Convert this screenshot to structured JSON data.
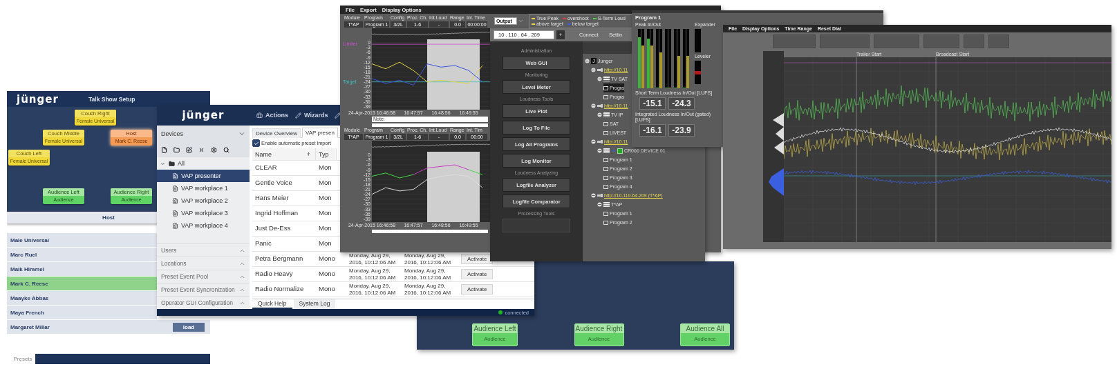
{
  "talk_show": {
    "logo": "jünger",
    "title": "Talk Show Setup",
    "seats": [
      {
        "name": "Couch Right",
        "preset": "Female Universal",
        "kind": "couch"
      },
      {
        "name": "Couch Middle",
        "preset": "Female Universal",
        "kind": "couch"
      },
      {
        "name": "Couch Left",
        "preset": "Female Universal",
        "kind": "couch"
      },
      {
        "name": "Host",
        "preset": "Mark C. Reese",
        "kind": "host"
      },
      {
        "name": "Audience Left",
        "preset": "Audience",
        "kind": "audience"
      },
      {
        "name": "Audience Right",
        "preset": "Audience",
        "kind": "audience"
      }
    ],
    "stage_caption": "Host",
    "presets": [
      {
        "name": "Male Universal",
        "selected": false
      },
      {
        "name": "Marc Ruel",
        "selected": false
      },
      {
        "name": "Maik Himmel",
        "selected": false
      },
      {
        "name": "Mark C. Reese",
        "selected": true
      },
      {
        "name": "Maayke Abbas",
        "selected": false
      },
      {
        "name": "Maya French",
        "selected": false
      },
      {
        "name": "Margaret Millar",
        "selected": false
      }
    ],
    "load_button": "load",
    "tab": "Presets"
  },
  "audience_panel": {
    "buttons": [
      {
        "name": "Audience Left",
        "preset": "Audience"
      },
      {
        "name": "Audience Right",
        "preset": "Audience"
      },
      {
        "name": "Audience All",
        "preset": "Audience"
      }
    ]
  },
  "device_manager": {
    "logo": "jünger",
    "nav": [
      "Actions",
      "Wizards"
    ],
    "sidebar": {
      "title": "Devices",
      "tree": {
        "label": "All",
        "expanded": true,
        "children": [
          {
            "label": "VAP presenter",
            "selected": true
          },
          {
            "label": "VAP workplace 1",
            "selected": false
          },
          {
            "label": "VAP workplace 2",
            "selected": false
          },
          {
            "label": "VAP workplace 3",
            "selected": false
          },
          {
            "label": "VAP workplace 4",
            "selected": false
          }
        ]
      },
      "sections": [
        "Users",
        "Locations",
        "Preset Event Pool",
        "Preset Event Syncronization",
        "Operator GUI Configuration"
      ]
    },
    "tabs": [
      {
        "label": "Device Overview",
        "selected": false
      },
      {
        "label": "VAP presen",
        "selected": true
      }
    ],
    "auto_import": {
      "label": "Enable automatic preset import",
      "checked": true
    },
    "table": {
      "columns": [
        "Name",
        "Typ"
      ],
      "rows": [
        {
          "cells": [
            "CLEAR",
            "Mon"
          ]
        },
        {
          "cells": [
            "Gentle Voice",
            "Mon"
          ]
        },
        {
          "cells": [
            "Hans Meier",
            "Mon"
          ]
        },
        {
          "cells": [
            "Ingrid Hoffman",
            "Mon"
          ]
        },
        {
          "cells": [
            "Just De-Ess",
            "Mon"
          ]
        },
        {
          "cells": [
            "Panic",
            "Mon"
          ]
        },
        {
          "cells": [
            "Petra Bergmann",
            "Mono",
            "Monday, Aug 29, 2016, 10:12:06 AM",
            "Monday, Aug 29, 2016, 10:12:06 AM"
          ],
          "action": "Activate"
        },
        {
          "cells": [
            "Radio Heavy",
            "Mono",
            "Monday, Aug 29, 2016, 10:12:06 AM",
            "Monday, Aug 29, 2016, 10:12:06 AM"
          ],
          "action": "Activate"
        },
        {
          "cells": [
            "Radio Normalize",
            "Mono",
            "Monday, Aug 29, 2016, 10:12:06 AM",
            "Monday, Aug 29, 2016, 10:12:06 AM"
          ],
          "action": "Activate"
        }
      ]
    },
    "bottom_tabs": [
      {
        "label": "Quick Help",
        "selected": true
      },
      {
        "label": "System Log",
        "selected": false
      }
    ],
    "status": "connected"
  },
  "plot_window": {
    "menu": [
      "File",
      "Export",
      "Display Options"
    ],
    "output": "Output",
    "legend": [
      {
        "label": "True Peak",
        "color": "#e8d84a"
      },
      {
        "label": "overshoot",
        "color": "#e04040"
      },
      {
        "label": "S-Term Loud",
        "color": "#4ccf4c"
      },
      {
        "label": "above target",
        "color": "#e8d84a"
      },
      {
        "label": "below target",
        "color": "#3a5fe0"
      }
    ],
    "plots": [
      {
        "fields": [
          {
            "label": "Module",
            "value": "T*AP"
          },
          {
            "label": "Program",
            "value": "Program 1"
          },
          {
            "label": "Config",
            "value": "3/2L"
          },
          {
            "label": "Proc. Ch.",
            "value": "1-6"
          },
          {
            "label": "Int.Loud",
            "value": "-"
          },
          {
            "label": "Range",
            "value": "0.0"
          },
          {
            "label": "Int. Time",
            "value": "00:00:00"
          }
        ],
        "chart_data": {
          "type": "line",
          "categories": [
            "24-Apr-2015 16:46:58",
            null,
            null,
            "16:47:57",
            null,
            "16:48:56",
            null,
            "16:49:55",
            null,
            null,
            null,
            null,
            null,
            null,
            null,
            null,
            null,
            null,
            null,
            null,
            null,
            null,
            null,
            null,
            null
          ],
          "ylim": [
            -41,
            2
          ],
          "yticks": [
            0,
            -3,
            -6,
            -9,
            -12,
            -15,
            -18,
            -21,
            -24,
            -27,
            -30,
            -33,
            -36,
            -39
          ],
          "grid": true,
          "ref_lines": [
            {
              "axis": "y",
              "value": -1,
              "label": "Limiter",
              "color": "#d050d0"
            },
            {
              "axis": "y",
              "value": -24,
              "label": "Target",
              "color": "#40c0c0"
            }
          ],
          "series": [
            {
              "color": "#e2d443",
              "values": [
                -13,
                -16,
                -12,
                -17,
                -24,
                -23,
                -24,
                -25,
                -14,
                null,
                null,
                null,
                null,
                null,
                null,
                null,
                null,
                null,
                null,
                null,
                null,
                null,
                null,
                null,
                null
              ]
            },
            {
              "color": "#3b55e0",
              "values": [
                -22,
                -25,
                -23,
                -26,
                -13,
                -15,
                -14,
                -17,
                -24,
                null,
                null,
                null,
                null,
                null,
                null,
                null,
                null,
                null,
                null,
                null,
                null,
                null,
                null,
                null,
                null
              ]
            }
          ]
        },
        "note": "Note:"
      },
      {
        "fields": [
          {
            "label": "Module",
            "value": "T*AP"
          },
          {
            "label": "Program",
            "value": "Program 1"
          },
          {
            "label": "Config",
            "value": "3/2L"
          },
          {
            "label": "Proc. Ch.",
            "value": "1-6"
          },
          {
            "label": "Int.Loud",
            "value": "-"
          },
          {
            "label": "Range",
            "value": "0.0"
          },
          {
            "label": "Int. Tim",
            "value": "00:00"
          }
        ],
        "chart_data": {
          "type": "line",
          "categories": [
            "24-Apr-2015 16:46:58",
            null,
            null,
            "16:47:57",
            null,
            "16:48:56",
            null,
            "16:49:55",
            null,
            null,
            null,
            null,
            null,
            null,
            null,
            null,
            null,
            null,
            null,
            null,
            null,
            null,
            null,
            null,
            null
          ],
          "ylim": [
            -41,
            2
          ],
          "yticks": [
            0,
            -3,
            -6,
            -9,
            -12,
            -15,
            -18,
            -21,
            -24,
            -27,
            -30,
            -33,
            -36,
            -39
          ],
          "grid": true,
          "series": [
            {
              "color": "#45d845",
              "values": [
                -13,
                -11,
                -14,
                -12,
                null,
                null,
                null,
                -9,
                -12,
                null,
                null,
                null,
                null,
                null,
                null,
                null,
                null,
                null,
                null,
                null,
                null,
                null,
                null,
                null,
                null
              ]
            },
            {
              "color": "#c33ec3",
              "values": [
                null,
                null,
                null,
                -12,
                -8,
                -7,
                -6,
                -9,
                null,
                null,
                null,
                null,
                null,
                null,
                null,
                null,
                null,
                null,
                null,
                null,
                null,
                null,
                null,
                null,
                null
              ]
            },
            {
              "color": "#dddddd",
              "values": [
                -24,
                -20,
                -22,
                -21,
                -15,
                -13,
                -12,
                -13,
                -20,
                null,
                null,
                null,
                null,
                null,
                null,
                null,
                null,
                null,
                null,
                null,
                null,
                null,
                null,
                null,
                null
              ]
            }
          ]
        }
      }
    ]
  },
  "launcher": {
    "ip": "10 . 110 . 64 . 209",
    "add": "+",
    "connect": "Connect",
    "settings": "Settin",
    "groups": [
      {
        "heading": "Administration",
        "buttons": [
          {
            "label": "Web GUI",
            "disabled": false
          }
        ]
      },
      {
        "heading": "Monitoring",
        "buttons": [
          {
            "label": "Level Meter",
            "disabled": false
          }
        ]
      },
      {
        "heading": "Loudness Tools",
        "buttons": [
          {
            "label": "Live Plot",
            "disabled": false
          },
          {
            "label": "Log To File",
            "disabled": false
          },
          {
            "label": "Log All Programs",
            "disabled": false
          },
          {
            "label": "Log Monitor",
            "disabled": false
          }
        ]
      },
      {
        "heading": "Loudness Analyzing",
        "buttons": [
          {
            "label": "Logfile Analyzer",
            "disabled": false
          },
          {
            "label": "Logfile Comparator",
            "disabled": false
          }
        ]
      },
      {
        "heading": "Processing Tools",
        "buttons": [
          {
            "disabled": true
          }
        ]
      }
    ],
    "tree": {
      "label": "Junger",
      "badge": "J",
      "kind": "root",
      "children": [
        {
          "label": "http://10.11",
          "kind": "link",
          "children": [
            {
              "label": "TV SAT",
              "kind": "device",
              "children": [
                {
                  "label": "Progra",
                  "kind": "program",
                  "selected": true
                },
                {
                  "label": "Progra",
                  "kind": "program",
                  "selected": false
                }
              ]
            }
          ]
        },
        {
          "label": "http://10.11",
          "kind": "link",
          "children": [
            {
              "label": "TV IP",
              "kind": "device",
              "children": [
                {
                  "label": "SAT",
                  "kind": "program",
                  "selected": false
                },
                {
                  "label": "LIVEST",
                  "kind": "program",
                  "selected": false
                }
              ]
            }
          ]
        },
        {
          "label": "http://10.11",
          "kind": "link",
          "children": [
            {
              "label": "CR066 DEVICE 01",
              "kind": "device",
              "checked": true,
              "children": [
                {
                  "label": "Program 1",
                  "kind": "program",
                  "selected": false
                },
                {
                  "label": "Program 2",
                  "kind": "program",
                  "selected": false
                },
                {
                  "label": "Program 3",
                  "kind": "program",
                  "selected": false
                },
                {
                  "label": "Program 4",
                  "kind": "program",
                  "selected": false
                }
              ]
            }
          ]
        },
        {
          "label": "http://10.110.64.209 (T*AP)",
          "kind": "link",
          "children": [
            {
              "label": "T*AP",
              "kind": "device",
              "children": [
                {
                  "label": "Program 1",
                  "kind": "program",
                  "selected": false
                },
                {
                  "label": "Program 2",
                  "kind": "program",
                  "selected": false
                }
              ]
            }
          ]
        }
      ]
    }
  },
  "meter_window": {
    "title": "Program 1",
    "peak_label": "Peak In/Out",
    "meters": [
      {
        "input": {
          "level": 0.86
        },
        "output": {
          "level": 0.72
        }
      },
      {
        "input": {
          "level": 0.84
        },
        "output": {
          "level": 0.72
        }
      },
      {
        "input": {
          "level": 0
        },
        "output": {
          "level": 0.6
        }
      },
      {
        "input": {
          "level": 0
        },
        "output": {
          "level": 0
        }
      },
      {
        "input": {
          "level": 0
        },
        "output": {
          "level": 0.55
        }
      },
      {
        "input": {
          "level": 0
        },
        "output": {
          "level": 0.55
        }
      }
    ],
    "expander_label": "Expander",
    "leveler_label": "Leveler",
    "short_term": {
      "label": "Short Term Loudness In/Out [LUFS]",
      "values": [
        "-15.1",
        "-24.3"
      ]
    },
    "integrated": {
      "label": "Integrated Loudness In/Out (gated) [LUFS]",
      "values": [
        "-16.1",
        "-23.9"
      ]
    }
  },
  "trend_window": {
    "menu": [
      "File",
      "Display Options",
      "Time Range",
      "Reset Dial"
    ],
    "markers": [
      "Trailer Start",
      "Broadcast Start"
    ]
  }
}
